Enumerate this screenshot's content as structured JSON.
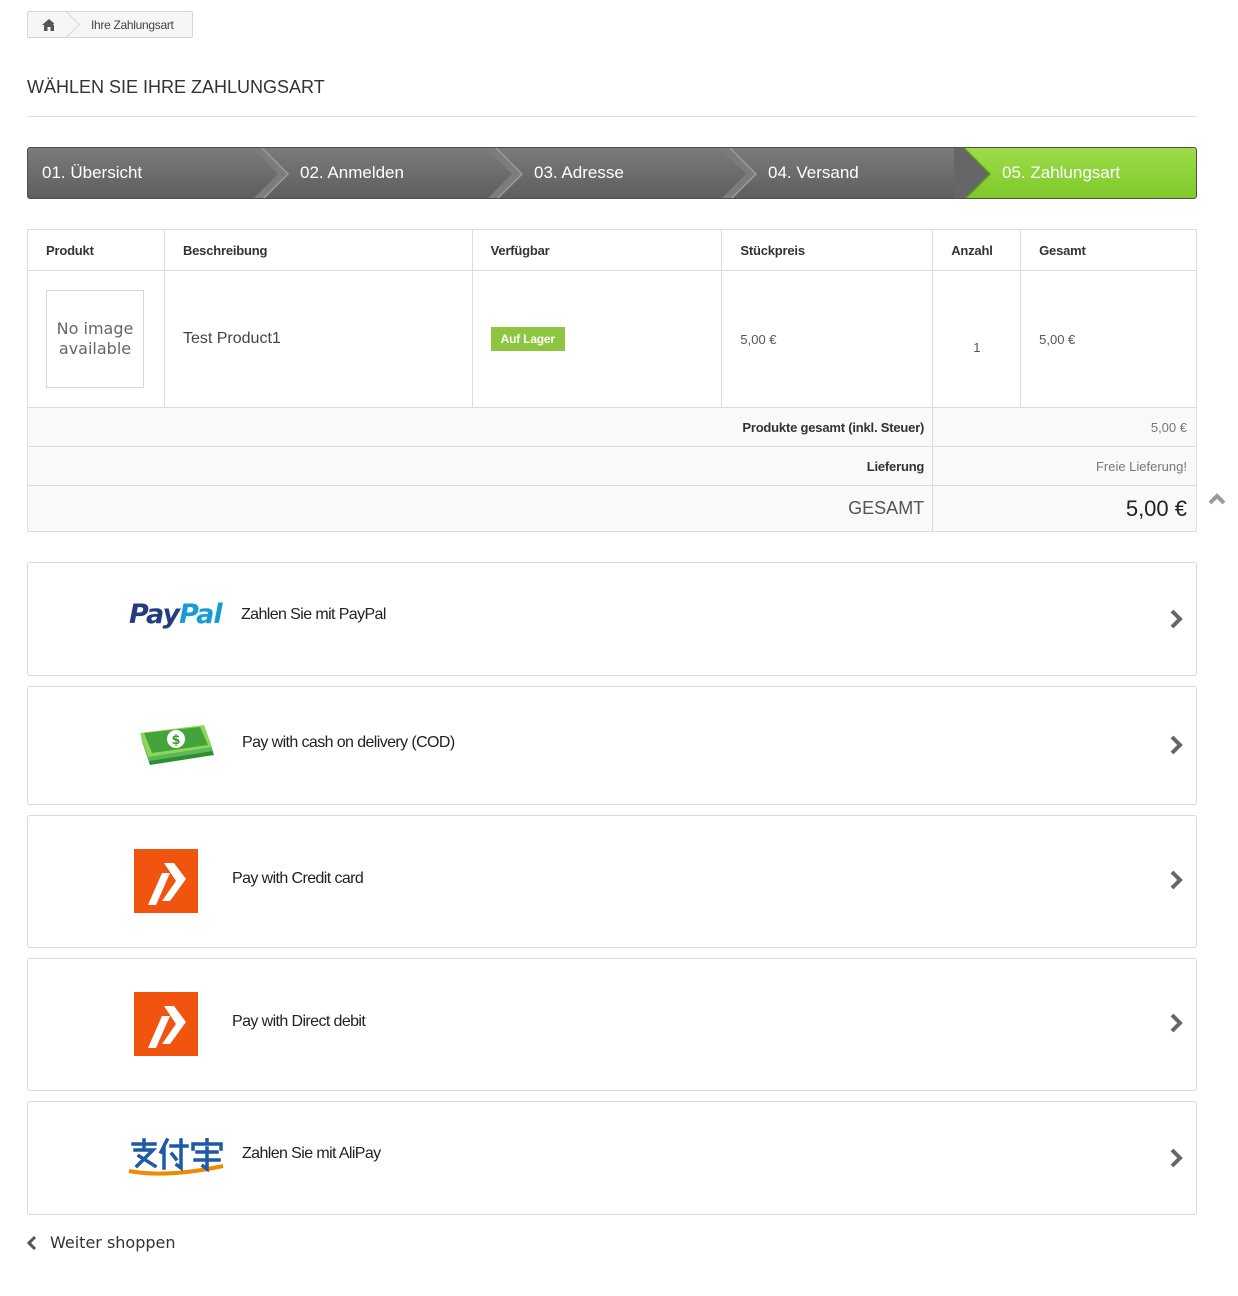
{
  "breadcrumb": {
    "home_icon": "home-icon",
    "current": "Ihre Zahlungsart"
  },
  "page_title": "WÄHLEN SIE IHRE ZAHLUNGSART",
  "steps": [
    {
      "label": "01. Übersicht",
      "active": false
    },
    {
      "label": "02. Anmelden",
      "active": false
    },
    {
      "label": "03. Adresse",
      "active": false
    },
    {
      "label": "04. Versand",
      "active": false
    },
    {
      "label": "05. Zahlungsart",
      "active": true
    }
  ],
  "cart": {
    "headers": [
      "Produkt",
      "Beschreibung",
      "Verfügbar",
      "Stückpreis",
      "Anzahl",
      "Gesamt"
    ],
    "item": {
      "image_placeholder_line1": "No image",
      "image_placeholder_line2": "available",
      "name": "Test Product1",
      "availability": "Auf Lager",
      "unit_price": "5,00 €",
      "quantity": "1",
      "total": "5,00 €"
    },
    "subtotal_label": "Produkte gesamt (inkl. Steuer)",
    "subtotal_value": "5,00 €",
    "shipping_label": "Lieferung",
    "shipping_value": "Freie Lieferung!",
    "total_label": "GESAMT",
    "total_value": "5,00 €"
  },
  "payments": [
    {
      "label": "Zahlen Sie mit PayPal",
      "logo": "paypal-logo",
      "logo_text_pay": "Pay",
      "logo_text_pal": "Pal"
    },
    {
      "label": "Pay with cash on delivery (COD)",
      "logo": "cash-icon"
    },
    {
      "label": "Pay with Credit card",
      "logo": "payment-provider-icon"
    },
    {
      "label": "Pay with Direct debit",
      "logo": "payment-provider-icon"
    },
    {
      "label": "Zahlen Sie mit AliPay",
      "logo": "alipay-logo"
    }
  ],
  "continue_label": "Weiter shoppen",
  "colors": {
    "step_active": "#8cc63f",
    "step_default": "#6b6b6b",
    "badge": "#8cc63f",
    "provider_orange": "#f0540f"
  }
}
